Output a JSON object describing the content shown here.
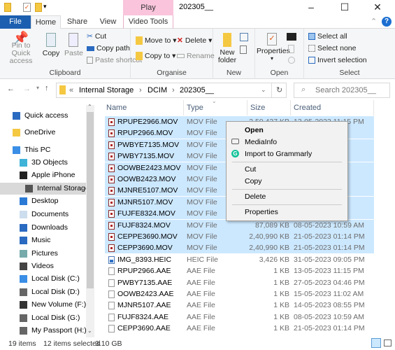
{
  "window": {
    "title": "202305__",
    "context_tab": "Play",
    "minimize": "–",
    "maximize": "☐",
    "close": "✕"
  },
  "tabs": [
    "File",
    "Home",
    "Share",
    "View",
    "Video Tools"
  ],
  "ribbon": {
    "clipboard": {
      "label": "Clipboard",
      "pin": "Pin to Quick access",
      "copy": "Copy",
      "paste": "Paste",
      "cut": "Cut",
      "copy_path": "Copy path",
      "paste_shortcut": "Paste shortcut"
    },
    "organise": {
      "label": "Organise",
      "move_to": "Move to ▾",
      "copy_to": "Copy to ▾",
      "delete": "Delete ▾",
      "rename": "Rename"
    },
    "new": {
      "label": "New",
      "new_folder": "New folder"
    },
    "open": {
      "label": "Open",
      "properties": "Properties"
    },
    "select": {
      "label": "Select",
      "select_all": "Select all",
      "select_none": "Select none",
      "invert": "Invert selection"
    }
  },
  "address": {
    "path": [
      "Internal Storage",
      "DCIM",
      "202305__"
    ],
    "search_placeholder": "Search 202305__"
  },
  "sidebar": [
    "Quick access",
    "OneDrive",
    "This PC",
    "3D Objects",
    "Apple iPhone",
    "Internal Storage",
    "Desktop",
    "Documents",
    "Downloads",
    "Music",
    "Pictures",
    "Videos",
    "Local Disk (C:)",
    "Local Disk (D:)",
    "New Volume (F:)",
    "Local Disk (G:)",
    "My Passport (H:)"
  ],
  "columns": [
    "Name",
    "Type",
    "Size",
    "Created"
  ],
  "files": [
    {
      "name": "RPUPE2966.MOV",
      "type": "MOV File",
      "size": "2,50,437 KB",
      "date": "13-05-2023 11:15 PM",
      "sel": true,
      "kind": "mov"
    },
    {
      "name": "RPUP2966.MOV",
      "type": "MOV File",
      "size": "",
      "date": "",
      "sel": true,
      "kind": "mov"
    },
    {
      "name": "PWBYE7135.MOV",
      "type": "MOV File",
      "size": "",
      "date": "",
      "sel": true,
      "kind": "mov"
    },
    {
      "name": "PWBY7135.MOV",
      "type": "MOV File",
      "size": "",
      "date": "",
      "sel": true,
      "kind": "mov"
    },
    {
      "name": "OOWBE2423.MOV",
      "type": "MOV File",
      "size": "",
      "date": "",
      "sel": true,
      "kind": "mov"
    },
    {
      "name": "OOWB2423.MOV",
      "type": "MOV File",
      "size": "",
      "date": "",
      "sel": true,
      "kind": "mov"
    },
    {
      "name": "MJNRE5107.MOV",
      "type": "MOV File",
      "size": "",
      "date": "",
      "sel": true,
      "kind": "mov"
    },
    {
      "name": "MJNR5107.MOV",
      "type": "MOV File",
      "size": "",
      "date": "",
      "sel": true,
      "kind": "mov"
    },
    {
      "name": "FUJFE8324.MOV",
      "type": "MOV File",
      "size": "",
      "date": "",
      "sel": true,
      "kind": "mov"
    },
    {
      "name": "FUJF8324.MOV",
      "type": "MOV File",
      "size": "87,089 KB",
      "date": "08-05-2023 10:59 AM",
      "sel": true,
      "kind": "mov"
    },
    {
      "name": "CEPPE3690.MOV",
      "type": "MOV File",
      "size": "2,40,990 KB",
      "date": "21-05-2023 01:14 PM",
      "sel": true,
      "kind": "mov"
    },
    {
      "name": "CEPP3690.MOV",
      "type": "MOV File",
      "size": "2,40,990 KB",
      "date": "21-05-2023 01:14 PM",
      "sel": true,
      "kind": "mov"
    },
    {
      "name": "IMG_8393.HEIC",
      "type": "HEIC File",
      "size": "3,426 KB",
      "date": "31-05-2023 09:05 PM",
      "sel": false,
      "kind": "heic"
    },
    {
      "name": "RPUP2966.AAE",
      "type": "AAE File",
      "size": "1 KB",
      "date": "13-05-2023 11:15 PM",
      "sel": false,
      "kind": "aae"
    },
    {
      "name": "PWBY7135.AAE",
      "type": "AAE File",
      "size": "1 KB",
      "date": "27-05-2023 04:46 PM",
      "sel": false,
      "kind": "aae"
    },
    {
      "name": "OOWB2423.AAE",
      "type": "AAE File",
      "size": "1 KB",
      "date": "15-05-2023 11:02 AM",
      "sel": false,
      "kind": "aae"
    },
    {
      "name": "MJNR5107.AAE",
      "type": "AAE File",
      "size": "1 KB",
      "date": "14-05-2023 08:55 PM",
      "sel": false,
      "kind": "aae"
    },
    {
      "name": "FUJF8324.AAE",
      "type": "AAE File",
      "size": "1 KB",
      "date": "08-05-2023 10:59 AM",
      "sel": false,
      "kind": "aae"
    },
    {
      "name": "CEPP3690.AAE",
      "type": "AAE File",
      "size": "1 KB",
      "date": "21-05-2023 01:14 PM",
      "sel": false,
      "kind": "aae"
    }
  ],
  "context_menu": {
    "open": "Open",
    "mediainfo": "MediaInfo",
    "grammarly": "Import to Grammarly",
    "cut": "Cut",
    "copy": "Copy",
    "delete": "Delete",
    "properties": "Properties"
  },
  "status": {
    "items": "19 items",
    "selected": "12 items selected",
    "size": "3.10 GB"
  },
  "colors": {
    "accent": "#1c5fb0",
    "selection": "#cce8ff",
    "play_tab": "#f9c4dc",
    "grammarly": "#15c39a"
  }
}
